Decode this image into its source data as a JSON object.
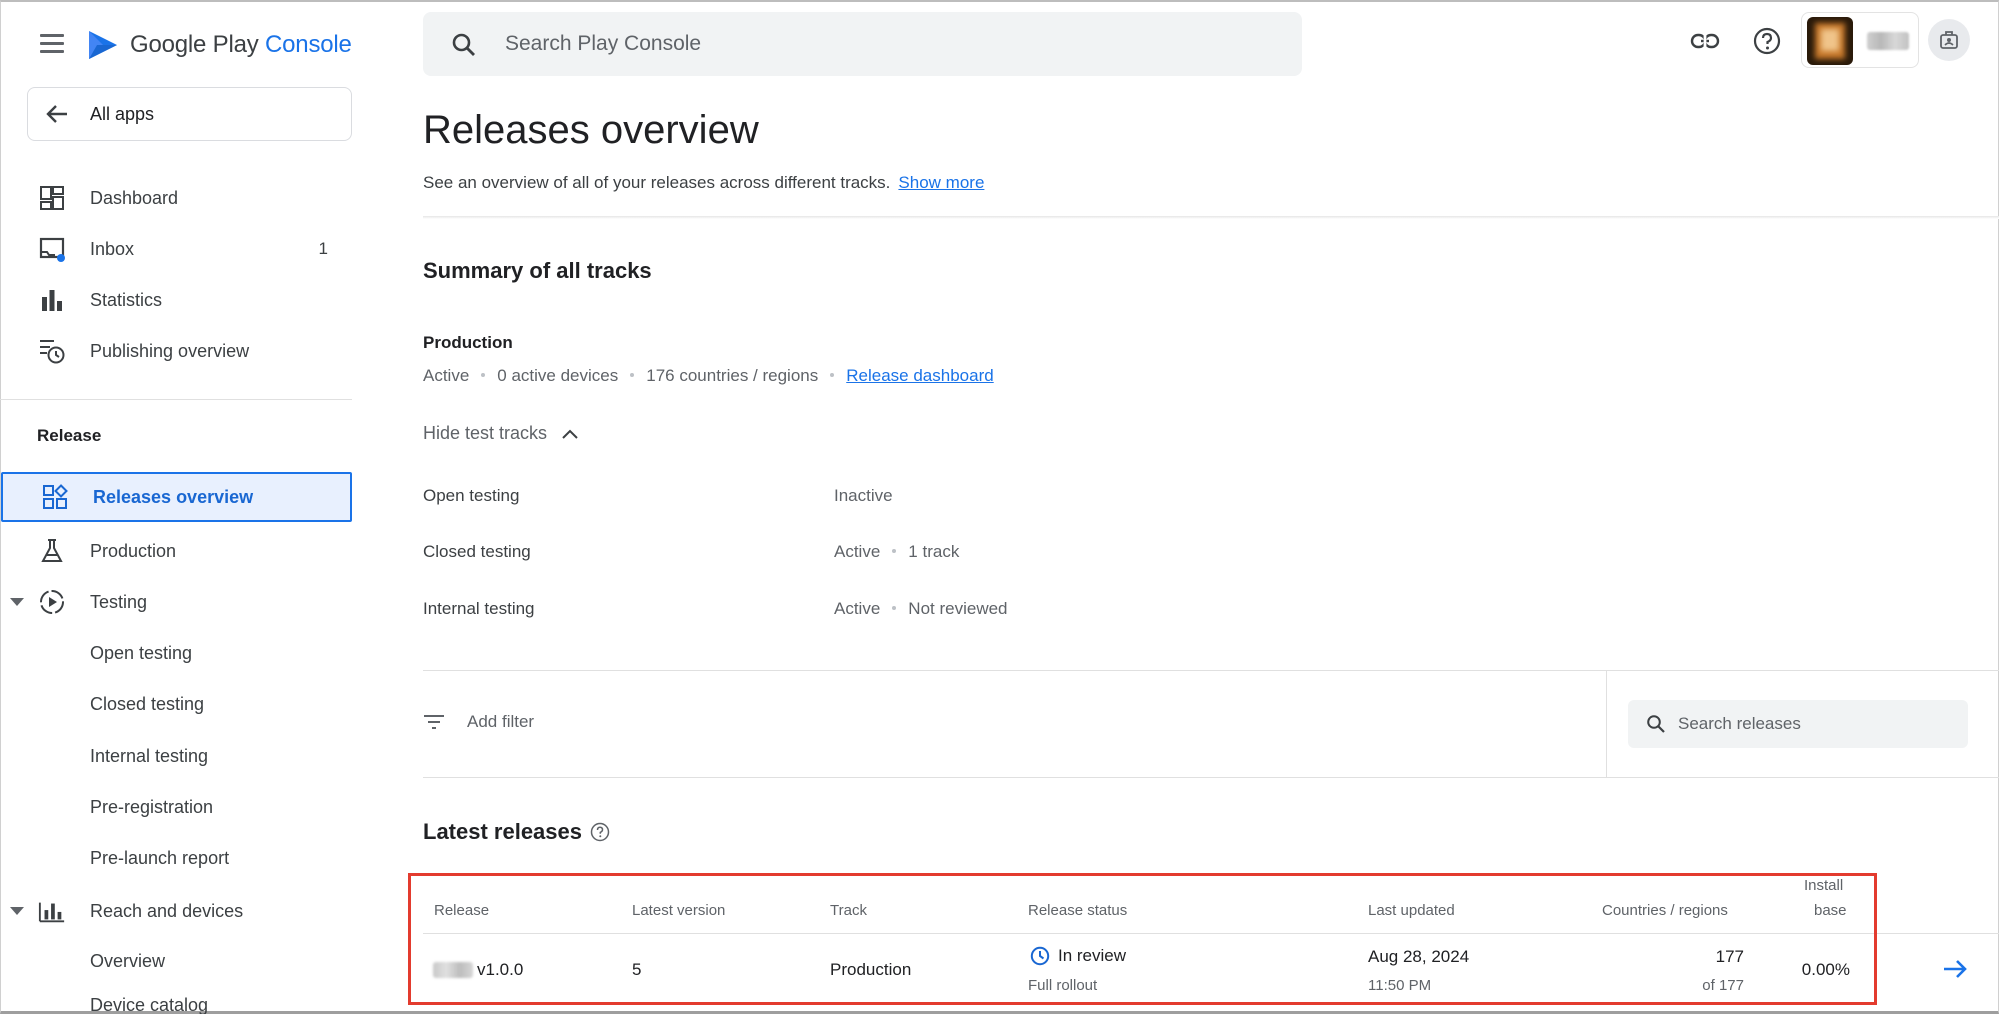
{
  "app": {
    "logo_text_main": "Google Play",
    "logo_text_accent": "Console",
    "brand_color": "#1a73e8"
  },
  "topbar": {
    "search_placeholder": "Search Play Console",
    "icons": [
      "link-icon",
      "help-icon",
      "account-switcher",
      "notifications-icon"
    ]
  },
  "sidebar": {
    "all_apps_label": "All apps",
    "items": [
      {
        "label": "Dashboard",
        "icon": "dashboard-icon"
      },
      {
        "label": "Inbox",
        "icon": "inbox-icon",
        "count": "1"
      },
      {
        "label": "Statistics",
        "icon": "statistics-icon"
      },
      {
        "label": "Publishing overview",
        "icon": "publishing-icon"
      }
    ],
    "release_section": "Release",
    "release_items": [
      {
        "label": "Releases overview",
        "icon": "releases-overview-icon",
        "active": true
      },
      {
        "label": "Production",
        "icon": "production-icon"
      },
      {
        "label": "Testing",
        "icon": "testing-icon"
      }
    ],
    "testing_children": [
      "Open testing",
      "Closed testing",
      "Internal testing",
      "Pre-registration",
      "Pre-launch report"
    ],
    "reach_label": "Reach and devices",
    "reach_children": [
      "Overview",
      "Device catalog"
    ]
  },
  "main": {
    "title": "Releases overview",
    "description": "See an overview of all of your releases across different tracks.",
    "show_more": "Show more",
    "summary_title": "Summary of all tracks",
    "production": {
      "name": "Production",
      "status": "Active",
      "devices": "0 active devices",
      "countries": "176 countries / regions",
      "link": "Release dashboard"
    },
    "hide_test_tracks": "Hide test tracks",
    "tracks": [
      {
        "name": "Open testing",
        "status": "Inactive",
        "extra": ""
      },
      {
        "name": "Closed testing",
        "status": "Active",
        "extra": "1 track"
      },
      {
        "name": "Internal testing",
        "status": "Active",
        "extra": "Not reviewed"
      }
    ],
    "add_filter": "Add filter",
    "search_releases": "Search releases",
    "latest_title": "Latest releases",
    "table": {
      "headers": {
        "release": "Release",
        "latest_version": "Latest version",
        "track": "Track",
        "release_status": "Release status",
        "last_updated": "Last updated",
        "countries": "Countries / regions",
        "install_base_1": "Install",
        "install_base_2": "base"
      },
      "rows": [
        {
          "release": "v1.0.0",
          "latest_version": "5",
          "track": "Production",
          "status": "In review",
          "status_sub": "Full rollout",
          "updated_date": "Aug 28, 2024",
          "updated_time": "11:50 PM",
          "countries": "177",
          "countries_sub": "of 177",
          "install_base": "0.00%"
        }
      ]
    },
    "highlight_color": "#e33b2e"
  }
}
